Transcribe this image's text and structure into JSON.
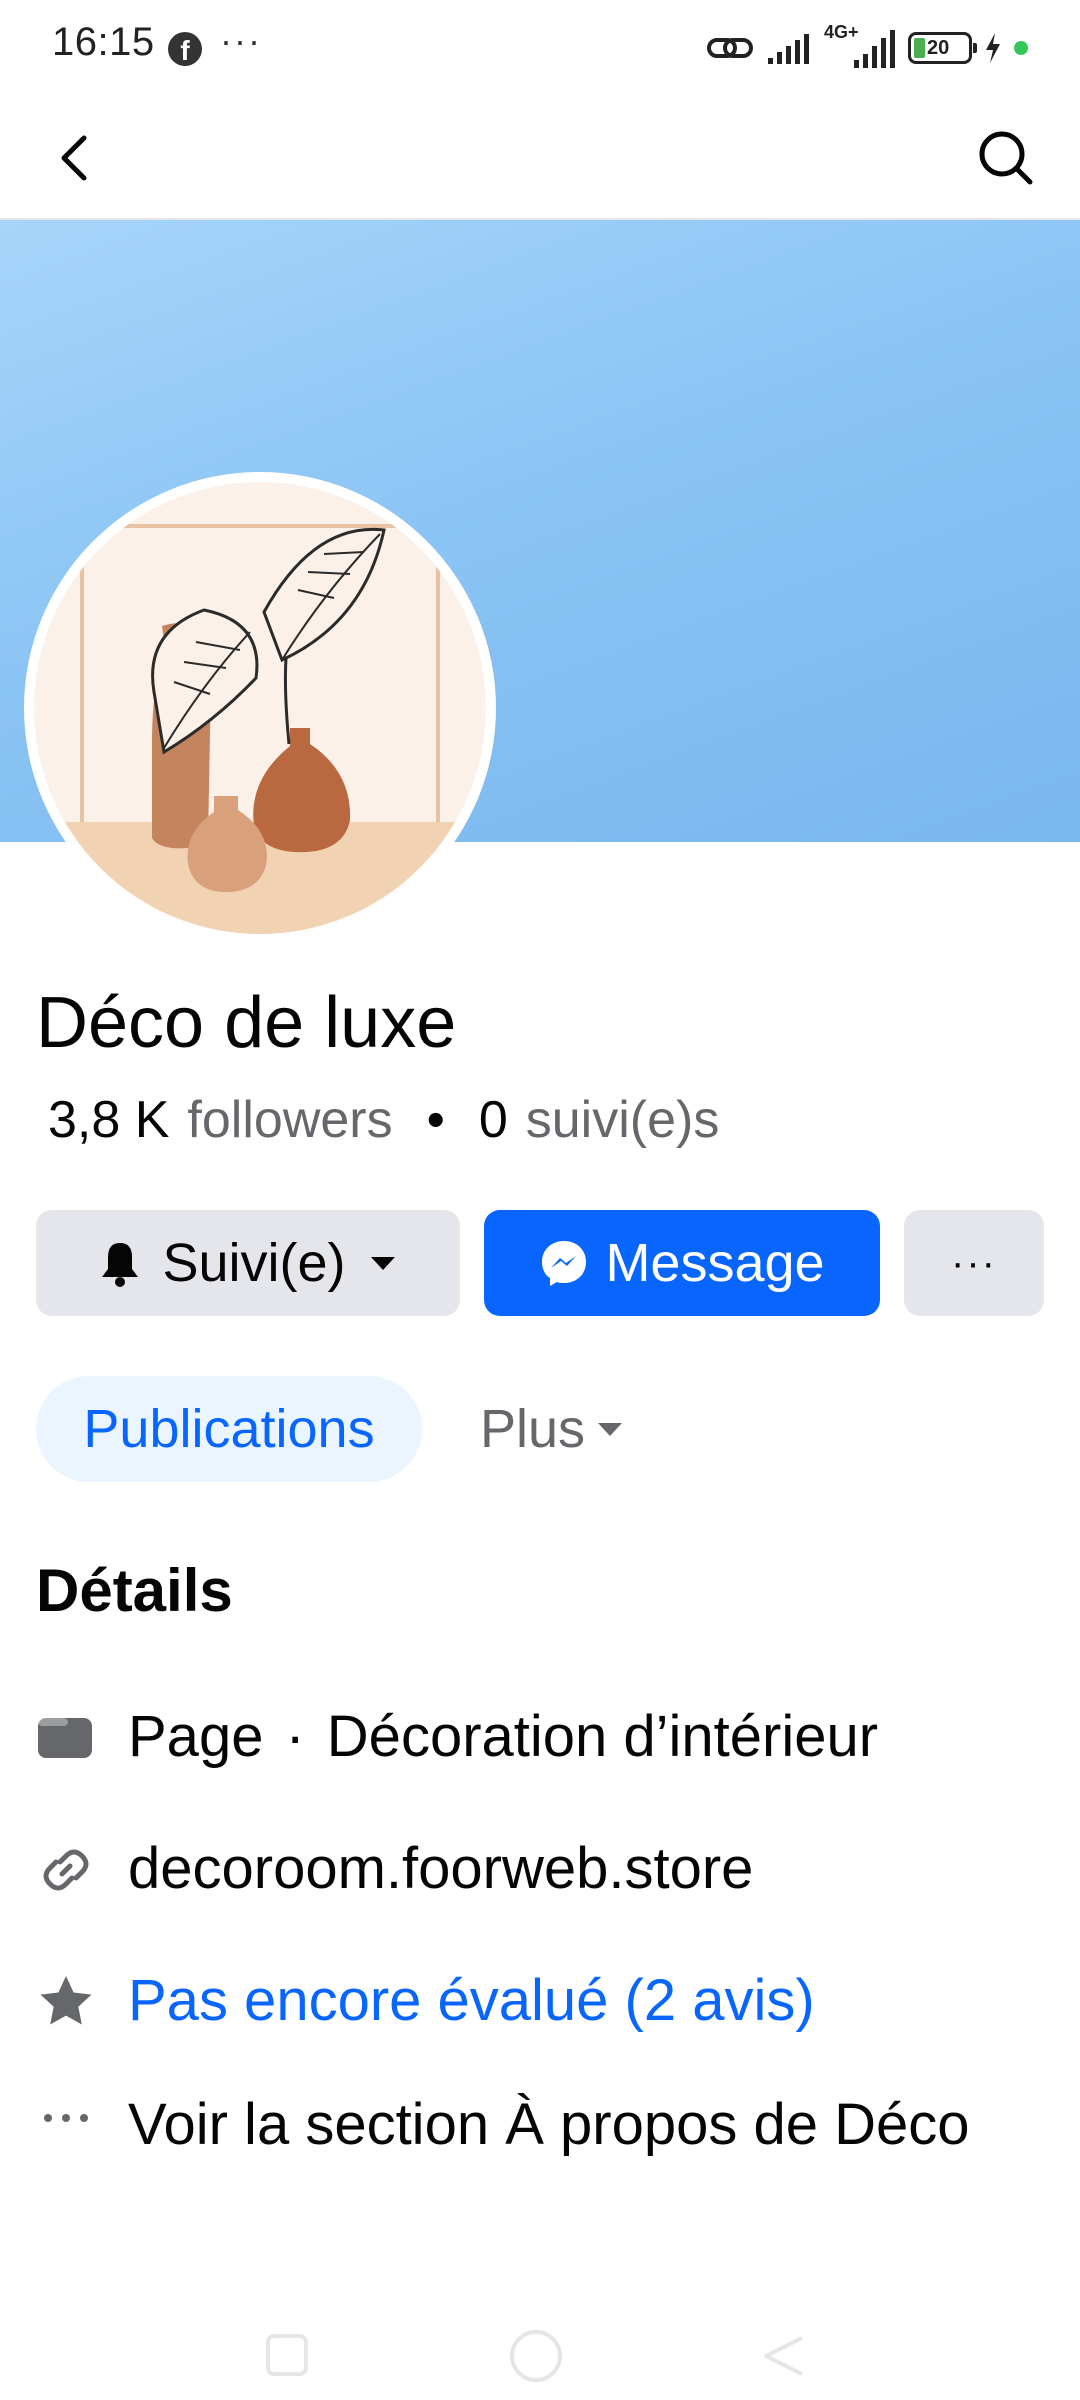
{
  "status_bar": {
    "time": "16:15",
    "more": "···",
    "network": "4G+",
    "battery": "20",
    "icons": [
      "facebook-icon",
      "link-icon",
      "signal-icon",
      "battery-icon",
      "charging-icon",
      "privacy-dot-icon"
    ]
  },
  "nav": {
    "back_icon": "chevron-left-icon",
    "search_icon": "search-icon"
  },
  "profile": {
    "name": "Déco de luxe",
    "followers_count": "3,8 K",
    "followers_label": "followers",
    "separator": "•",
    "following_count": "0",
    "following_label": "suivi(e)s",
    "cover_color": "#8bc4f4"
  },
  "actions": {
    "follow_label": "Suivi(e)",
    "message_label": "Message",
    "more_label": "···"
  },
  "tabs": {
    "active_label": "Publications",
    "plus_label": "Plus"
  },
  "details": {
    "title": "Détails",
    "page_label": "Page",
    "page_sep": "·",
    "category": "Décoration d’intérieur",
    "website": "decoroom.foorweb.store",
    "rating": "Pas encore évalué (2 avis)",
    "about": "Voir la section À propos de Déco"
  },
  "colors": {
    "accent": "#0866ff",
    "button_gray": "#e4e6eb",
    "secondary_text": "#65676b",
    "active_tab_bg": "#ebf5ff"
  }
}
